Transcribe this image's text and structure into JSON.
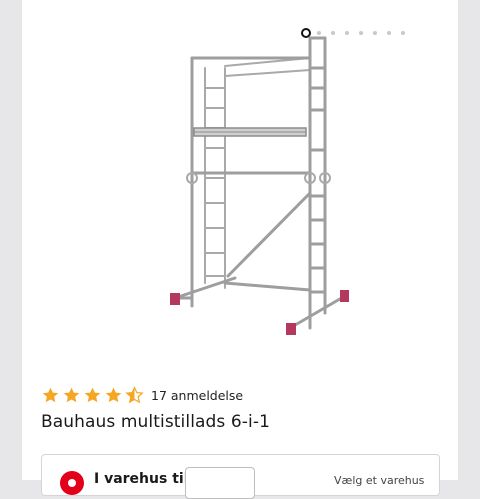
{
  "gallery": {
    "image_icon": "scaffold-product-image",
    "slide_count": 8,
    "active_slide": 1
  },
  "product": {
    "rating": 4.5,
    "rating_max": 5,
    "review_count_label": "17 anmeldelse",
    "name": "Bauhaus multistillads 6-i-1"
  },
  "store_panel": {
    "label": "I varehus til",
    "quantity_value": "",
    "right_text": "Vælg et varehus"
  },
  "colors": {
    "star": "#f5a623",
    "brand_red": "#e2001a",
    "scaffold_feet": "#b5385f"
  }
}
